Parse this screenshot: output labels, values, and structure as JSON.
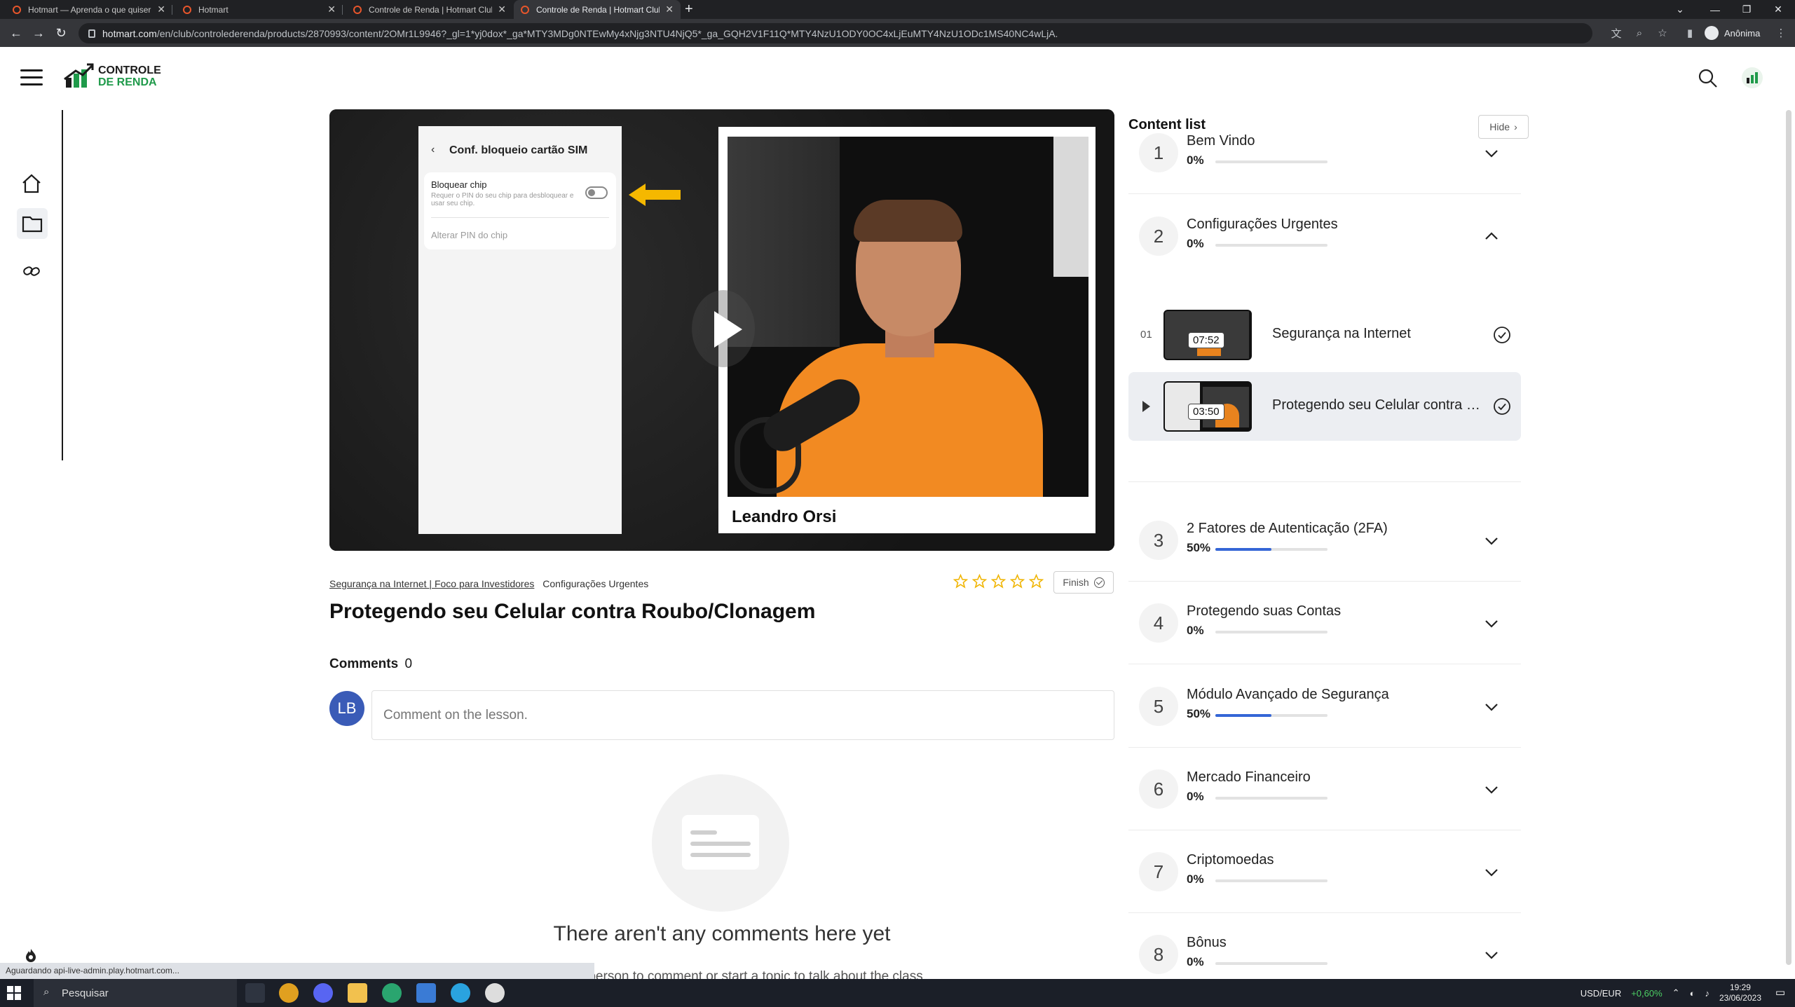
{
  "browser": {
    "tabs": [
      {
        "title": "Hotmart — Aprenda o que quiser",
        "active": false
      },
      {
        "title": "Hotmart",
        "active": false
      },
      {
        "title": "Controle de Renda | Hotmart Club",
        "active": false
      },
      {
        "title": "Controle de Renda | Hotmart Club",
        "active": true
      }
    ],
    "url_host": "hotmart.com",
    "url_path": "/en/club/controlederenda/products/2870993/content/2OMr1L9946?_gl=1*yj0dox*_ga*MTY3MDg0NTEwMy4xNjg3NTU4NjQ5*_ga_GQH2V1F11Q*MTY4NzU1ODY0OC4xLjEuMTY4NzU1ODc1MS40NC4wLjA.",
    "profile_label": "Anônima",
    "status_text": "Aguardando api-live-admin.play.hotmart.com..."
  },
  "header": {
    "logo_line1": "CONTROLE",
    "logo_line2": "DE RENDA"
  },
  "sidebar": {
    "items": [
      {
        "icon": "home-icon"
      },
      {
        "icon": "folder-icon",
        "active": true
      },
      {
        "icon": "link-icon"
      }
    ]
  },
  "video": {
    "phone_header": "Conf. bloqueio cartão SIM",
    "phone_option": "Bloquear chip",
    "phone_option_desc": "Requer o PIN do seu chip para desbloquear e usar seu chip.",
    "phone_option2": "Alterar PIN do chip",
    "presenter_name": "Leandro Orsi"
  },
  "lesson": {
    "breadcrumb_course": "Segurança na Internet | Foco para Investidores",
    "breadcrumb_module": "Configurações Urgentes",
    "title": "Protegendo seu Celular contra Roubo/Clonagem",
    "finish_label": "Finish",
    "rating_stars": 5,
    "rating_value": 0
  },
  "comments": {
    "label": "Comments",
    "count": "0",
    "avatar_initials": "LB",
    "placeholder": "Comment on the lesson.",
    "empty_title": "There aren't any comments here yet",
    "empty_subtitle": "Be the first person to comment or start a topic to talk about the class"
  },
  "content_list": {
    "title": "Content list",
    "hide_label": "Hide",
    "modules": [
      {
        "num": "1",
        "title": "Bem Vindo",
        "percent": "0%",
        "progress": 0,
        "expanded": false
      },
      {
        "num": "2",
        "title": "Configurações Urgentes",
        "percent": "0%",
        "progress": 0,
        "expanded": true
      },
      {
        "num": "3",
        "title": "2 Fatores de Autenticação (2FA)",
        "percent": "50%",
        "progress": 0.5,
        "expanded": false
      },
      {
        "num": "4",
        "title": "Protegendo suas Contas",
        "percent": "0%",
        "progress": 0,
        "expanded": false
      },
      {
        "num": "5",
        "title": "Módulo Avançado de Segurança",
        "percent": "50%",
        "progress": 0.5,
        "expanded": false
      },
      {
        "num": "6",
        "title": "Mercado Financeiro",
        "percent": "0%",
        "progress": 0,
        "expanded": false
      },
      {
        "num": "7",
        "title": "Criptomoedas",
        "percent": "0%",
        "progress": 0,
        "expanded": false
      },
      {
        "num": "8",
        "title": "Bônus",
        "percent": "0%",
        "progress": 0,
        "expanded": false
      }
    ],
    "lessons": [
      {
        "num": "01",
        "title": "Segurança na Internet",
        "duration": "07:52",
        "active": false,
        "completed": true
      },
      {
        "num": "",
        "title": "Protegendo seu Celular contra Roubo/Clonagem",
        "duration": "03:50",
        "active": true,
        "completed": true
      }
    ]
  },
  "taskbar": {
    "search_label": "Pesquisar",
    "currency_label": "USD/EUR",
    "currency_change": "+0,60%",
    "time": "19:29",
    "date": "23/06/2023"
  },
  "colors": {
    "accent_blue": "#3566d6",
    "brand_green": "#1f9a4a",
    "star_yellow": "#f0b400",
    "avatar_blue": "#3a5bb7"
  }
}
